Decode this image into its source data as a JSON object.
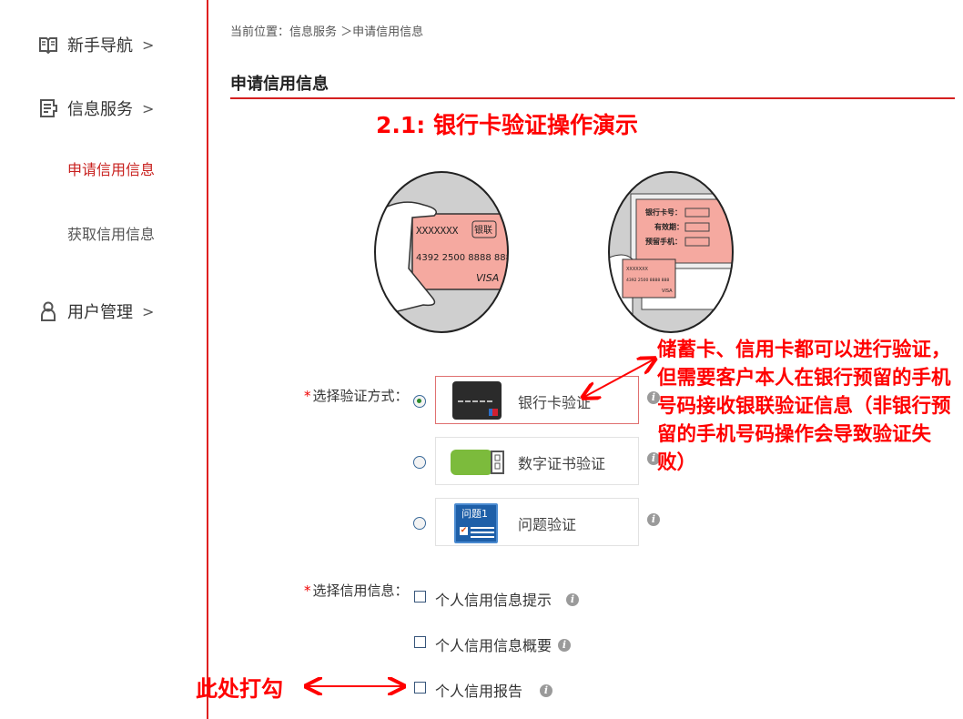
{
  "sidebar": {
    "items": [
      {
        "label": "新手导航",
        "icon": "book-icon",
        "chevron": ">"
      },
      {
        "label": "信息服务",
        "icon": "document-icon",
        "chevron": ">"
      },
      {
        "label": "申请信用信息",
        "active": true
      },
      {
        "label": "获取信用信息"
      },
      {
        "label": "用户管理",
        "icon": "user-icon",
        "chevron": ">"
      }
    ]
  },
  "breadcrumb": "当前位置：信息服务 ＞申请信用信息",
  "page_title": "申请信用信息",
  "demo_title": "2.1: 银行卡验证操作演示",
  "illustration": {
    "card_name": "XXXXXXX",
    "card_logo": "银联",
    "card_number": "4392 2500 8888 888",
    "card_brand": "VISA",
    "form_fields": [
      "银行卡号：",
      "有效期：",
      "预留手机："
    ]
  },
  "verify": {
    "label": "选择验证方式：",
    "required_mark": "*",
    "options": [
      {
        "label": "银行卡验证",
        "selected": true,
        "icon": "bank-card-icon"
      },
      {
        "label": "数字证书验证",
        "selected": false,
        "icon": "usb-key-icon"
      },
      {
        "label": "问题验证",
        "selected": false,
        "icon": "question-card-icon",
        "icon_text": "问题1"
      }
    ]
  },
  "credit": {
    "label": "选择信用信息：",
    "required_mark": "*",
    "options": [
      {
        "label": "个人信用信息提示",
        "checked": false
      },
      {
        "label": "个人信用信息概要",
        "checked": false
      },
      {
        "label": "个人信用报告",
        "checked": false
      }
    ]
  },
  "annotations": {
    "note": "储蓄卡、信用卡都可以进行验证，但需要客户本人在银行预留的手机号码接收银联验证信息（非银行预留的手机号码操作会导致验证失败）",
    "check_here": "此处打勾"
  },
  "colors": {
    "accent": "#d42020",
    "annotation": "#ff0000"
  }
}
